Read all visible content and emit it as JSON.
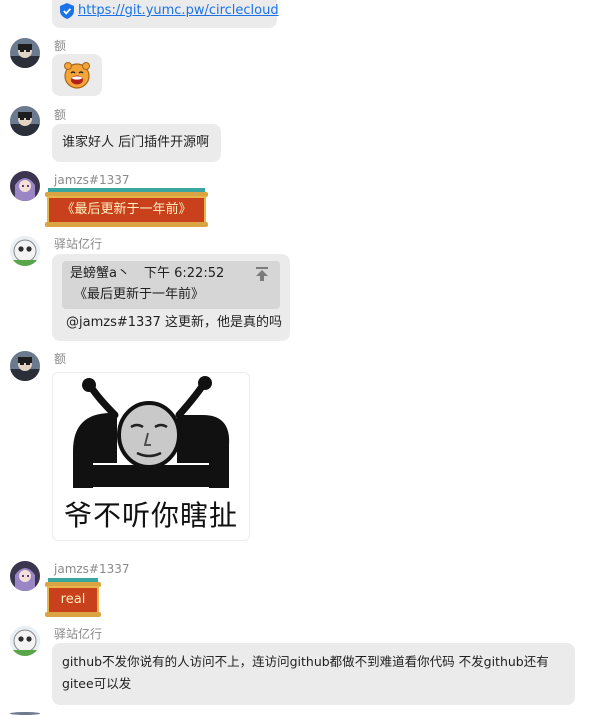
{
  "messages": {
    "m0": {
      "link": "https://git.yumc.pw/circlecloud"
    },
    "m1": {
      "sender": "额",
      "sticker_icon": "laughing-bear-sticker"
    },
    "m2": {
      "sender": "额",
      "text": "谁家好人 后门插件开源啊"
    },
    "m3": {
      "sender": "jamzs#1337",
      "banner_text": "《最后更新于一年前》"
    },
    "m4": {
      "sender": "驿站亿行",
      "quote": {
        "author": "是螃蟹a丶",
        "time": "下午 6:22:52",
        "text": "《最后更新于一年前》"
      },
      "reply": "@jamzs#1337  这更新，他是真的吗"
    },
    "m5": {
      "sender": "额",
      "meme_caption": "爷不听你瞎扯"
    },
    "m6": {
      "sender": "jamzs#1337",
      "banner_text": "real"
    },
    "m7": {
      "sender": "驿站亿行",
      "line1": "github不发你说有的人访问不上，连访问github都做不到难道看你代码 不发github还有",
      "line2": "gitee可以发"
    }
  },
  "colors": {
    "bubble": "#ebebeb",
    "link": "#1a73e8",
    "banner_red": "#c8401c",
    "banner_teal": "#3aa6a0",
    "banner_gold": "#d9a441"
  }
}
